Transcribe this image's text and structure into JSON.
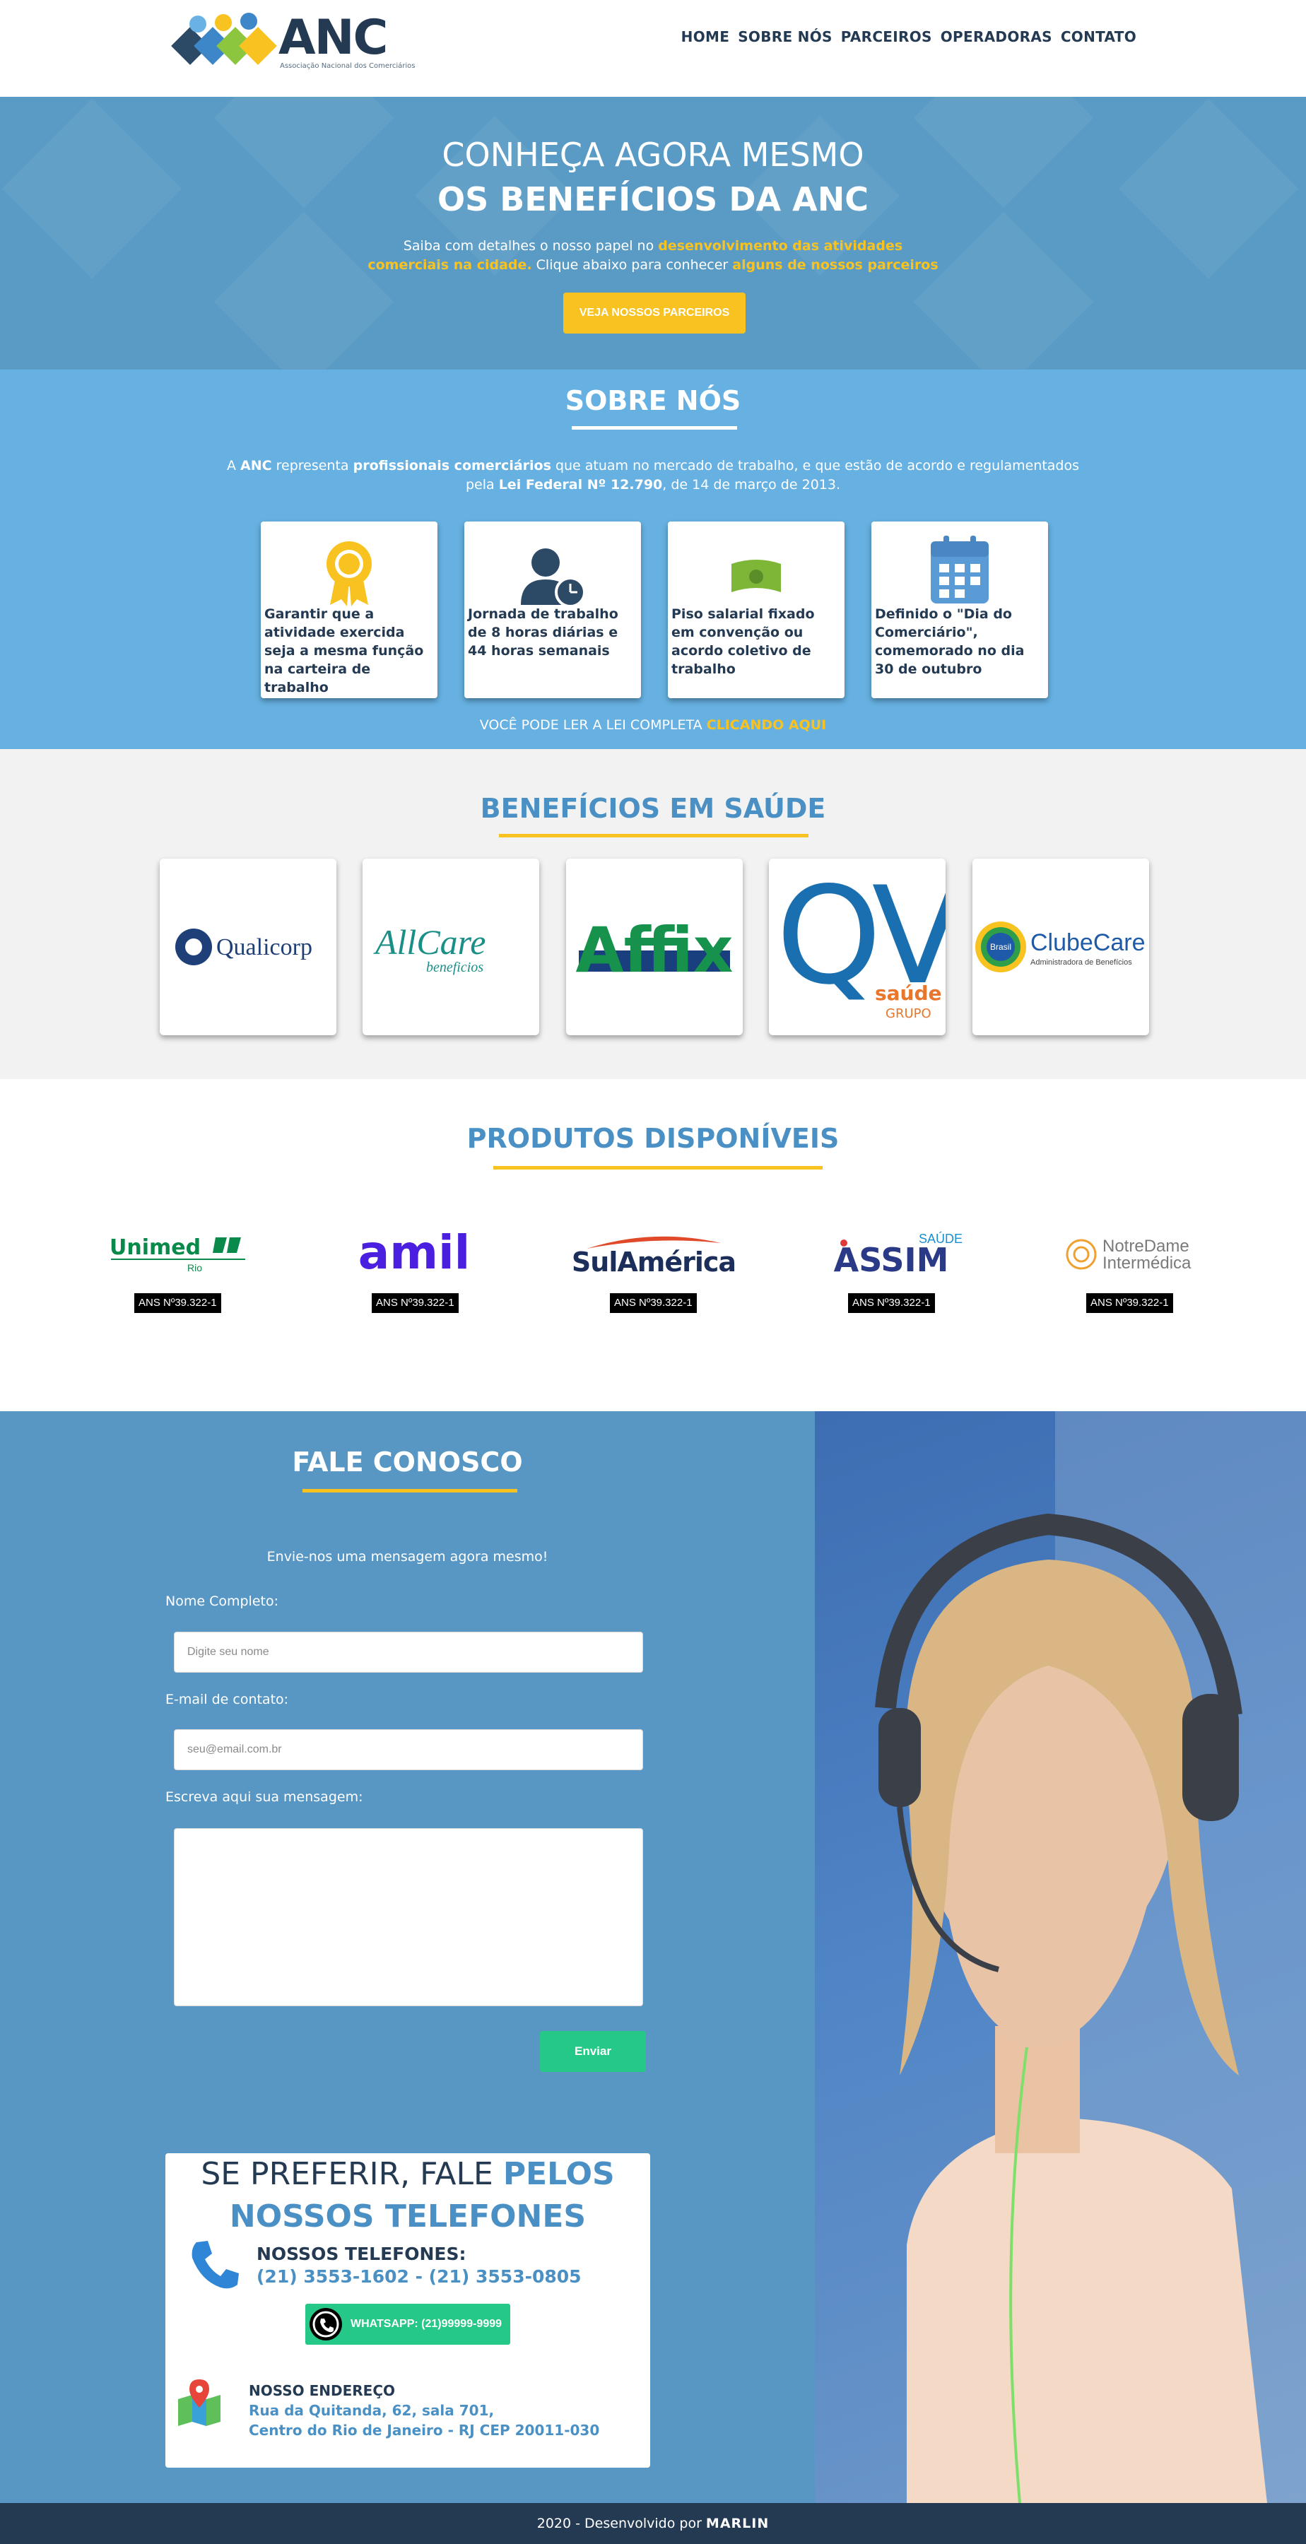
{
  "header": {
    "logo_text": "ANC",
    "logo_sub": "Associação Nacional dos Comerciários",
    "nav": [
      "HOME",
      "SOBRE NÓS",
      "PARCEIROS",
      "OPERADORAS",
      "CONTATO"
    ]
  },
  "hero": {
    "title1": "CONHEÇA AGORA MESMO",
    "title2": "OS BENEFÍCIOS DA ANC",
    "sub_a": "Saiba com detalhes o nosso papel no ",
    "sub_hl1": "desenvolvimento das atividades comerciais na cidade.",
    "sub_b": " Clique abaixo para conhecer ",
    "sub_hl2": "alguns de nossos parceiros",
    "button": "VEJA NOSSOS PARCEIROS"
  },
  "sobre": {
    "title": "SOBRE NÓS",
    "text_a": "A ",
    "text_b1": "ANC",
    "text_c": " representa ",
    "text_b2": "profissionais comerciários",
    "text_d": " que atuam no mercado de trabalho, e que estão de acordo e regulamentados pela ",
    "text_b3": "Lei Federal Nº 12.790",
    "text_e": ", de 14 de março de 2013.",
    "cards": [
      {
        "icon": "award-ribbon-icon",
        "text": "Garantir que a atividade exercida seja a mesma função na carteira de trabalho"
      },
      {
        "icon": "user-clock-icon",
        "text": "Jornada de trabalho de 8 horas diárias e 44 horas semanais"
      },
      {
        "icon": "money-bill-icon",
        "text": "Piso salarial fixado em convenção ou acordo coletivo de trabalho"
      },
      {
        "icon": "calendar-icon",
        "text": "Definido o \"Dia do Comerciário\", comemorado no dia 30 de outubro"
      }
    ],
    "lei_text": "VOCÊ PODE LER A LEI COMPLETA ",
    "lei_link": "CLICANDO AQUI"
  },
  "beneficios": {
    "title": "BENEFÍCIOS EM SAÚDE",
    "partners": [
      "Qualicorp",
      "AllCare",
      "beneficios",
      "Affix",
      "QV",
      "saúde",
      "GRUPO",
      "Brasil",
      "ClubeCare",
      "Administradora de Benefícios"
    ]
  },
  "produtos": {
    "title": "PRODUTOS DISPONÍVEIS",
    "logos": [
      "Unimed",
      "Rio",
      "amil",
      "SulAmérica",
      "SAÚDE",
      "ASSIM",
      "NotreDame",
      "Intermédica"
    ],
    "ans": [
      "ANS Nº39.322-1",
      "ANS Nº39.322-1",
      "ANS Nº39.322-1",
      "ANS Nº39.322-1",
      "ANS Nº39.322-1"
    ]
  },
  "contato": {
    "title": "FALE CONOSCO",
    "intro": "Envie-nos uma mensagem agora mesmo!",
    "name_label": "Nome Completo:",
    "name_placeholder": "Digite seu nome",
    "email_label": "E-mail de contato:",
    "email_placeholder": "seu@email.com.br",
    "msg_label": "Escreva aqui sua mensagem:",
    "send": "Enviar",
    "tel_title_a": "SE PREFERIR, FALE ",
    "tel_title_b": "PELOS NOSSOS TELEFONES",
    "tel_heading": "NOSSOS TELEFONES:",
    "tel_numbers": "(21) 3553-1602 - (21) 3553-0805",
    "whatsapp": "WHATSAPP: (21)99999-9999",
    "end_heading": "NOSSO ENDEREÇO",
    "end_line1": "Rua da Quitanda, 62, sala 701,",
    "end_line2": "Centro do Rio de Janeiro - RJ CEP 20011-030"
  },
  "footer": {
    "text": "2020 - Desenvolvido por ",
    "brand": "MARLIN"
  },
  "colors": {
    "brand_dark": "#243a52",
    "accent_yellow": "#f8c320",
    "accent_blue": "#4a90c4",
    "green": "#25c886"
  }
}
